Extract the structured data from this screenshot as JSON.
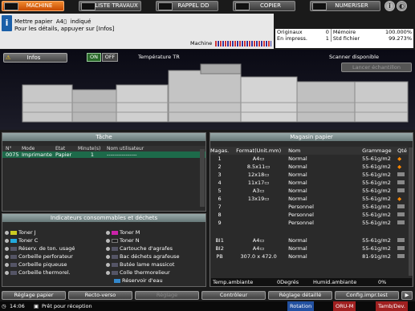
{
  "tabs": [
    {
      "label": "MACHINE",
      "active": true
    },
    {
      "label": "LISTE TRAVAUX"
    },
    {
      "label": "RAPPEL DD"
    },
    {
      "label": "COPIER"
    },
    {
      "label": "NUMERISER"
    }
  ],
  "message": {
    "line1_a": "Mettre papier",
    "line1_size": "A4▯",
    "line1_b": "indiqué",
    "line2": "Pour les détails, appuyer sur [Infos]"
  },
  "machine_label": "Machine",
  "stats": {
    "originaux_label": "Originaux",
    "originaux_value": "0",
    "memoire_label": "Mémoire",
    "memoire_value": "100.000%",
    "impress_label": "En impress.",
    "impress_value": "1",
    "std_label": "Std fichier",
    "std_value": "99.273%"
  },
  "info_btn": "Infos",
  "on": "ON",
  "off": "OFF",
  "temp_label": "Température TR",
  "scanner_status": "Scanner disponible",
  "sample_btn": "Lancer échantillon",
  "task_panel": {
    "title": "Tâche",
    "headers": [
      "N°",
      "Mode",
      "Etat",
      "Minute(s)",
      "Nom utilisateur"
    ],
    "rows": [
      {
        "no": "0075",
        "mode": "Imprimante",
        "etat": "Papier",
        "min": "1",
        "user": "----------------"
      }
    ]
  },
  "consumables": {
    "title": "Indicateurs consommables et déchets",
    "left": [
      "Toner J",
      "Toner C",
      "Réserv. de ton. usagé",
      "Corbeille perforateur",
      "Corbeille piqueuse",
      "Corbeille thermorel."
    ],
    "right": [
      "Toner M",
      "Toner N",
      "Cartouche d'agrafes",
      "Bac déchets agrafeuse",
      "Butée lame massicot",
      "Colle thermorelieur",
      "Réservoir d'eau"
    ]
  },
  "tray_panel": {
    "title": "Magasin papier",
    "headers": [
      "Magas.",
      "Format(Unit.mm)",
      "Nom",
      "Grammage",
      "Qté"
    ],
    "rows": [
      {
        "mag": "1",
        "fmt": "A4▭",
        "nom": "Normal",
        "gram": "55-61g/m2",
        "warn": true
      },
      {
        "mag": "2",
        "fmt": "8.5x11▭",
        "nom": "Normal",
        "gram": "55-61g/m2",
        "warn": true
      },
      {
        "mag": "3",
        "fmt": "12x18▭",
        "nom": "Normal",
        "gram": "55-61g/m2"
      },
      {
        "mag": "4",
        "fmt": "11x17▭",
        "nom": "Normal",
        "gram": "55-61g/m2"
      },
      {
        "mag": "5",
        "fmt": "A3▭",
        "nom": "Normal",
        "gram": "55-61g/m2"
      },
      {
        "mag": "6",
        "fmt": "13x19▭",
        "nom": "Normal",
        "gram": "55-61g/m2",
        "warn": true
      },
      {
        "mag": "7",
        "fmt": "",
        "nom": "Personnel",
        "gram": "55-61g/m2"
      },
      {
        "mag": "8",
        "fmt": "",
        "nom": "Personnel",
        "gram": "55-61g/m2"
      },
      {
        "mag": "9",
        "fmt": "",
        "nom": "Personnel",
        "gram": "55-61g/m2"
      },
      {
        "mag": "BI1",
        "fmt": "A4▭",
        "nom": "Normal",
        "gram": "55-61g/m2"
      },
      {
        "mag": "BI2",
        "fmt": "A4▭",
        "nom": "Normal",
        "gram": "55-61g/m2"
      },
      {
        "mag": "PB",
        "fmt": "307.0 x 472.0",
        "nom": "Normal",
        "gram": "81-91g/m2"
      }
    ]
  },
  "temp": {
    "amb_label": "Temp.ambiante",
    "amb_value": "0Degrés",
    "hum_label": "Humid.ambiante",
    "hum_value": "0%"
  },
  "bottom_buttons": [
    "Réglage papier",
    "Recto-verso",
    "Réglage",
    "Contrôleur",
    "Réglage détaillé",
    "Config.impr.test"
  ],
  "status": {
    "time": "14:06",
    "ready": "Prêt pour réception",
    "rotation": "Rotation",
    "oru": "ORU-M",
    "tamb": "Tamb/Dev."
  }
}
